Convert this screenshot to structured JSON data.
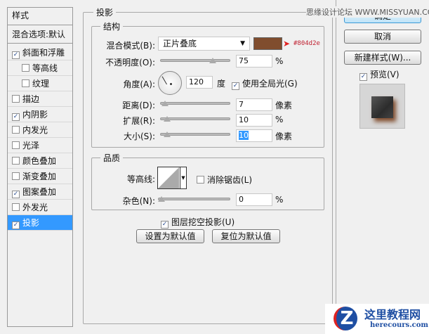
{
  "sidebar": {
    "title": "样式",
    "blend_options": "混合选项:默认",
    "items": [
      {
        "label": "斜面和浮雕",
        "checked": true
      },
      {
        "label": "等高线",
        "checked": false
      },
      {
        "label": "纹理",
        "checked": false
      },
      {
        "label": "描边",
        "checked": false
      },
      {
        "label": "内阴影",
        "checked": true
      },
      {
        "label": "内发光",
        "checked": false
      },
      {
        "label": "光泽",
        "checked": false
      },
      {
        "label": "颜色叠加",
        "checked": false
      },
      {
        "label": "渐变叠加",
        "checked": false
      },
      {
        "label": "图案叠加",
        "checked": true
      },
      {
        "label": "外发光",
        "checked": false
      },
      {
        "label": "投影",
        "checked": true,
        "selected": true
      }
    ]
  },
  "panel": {
    "title": "投影",
    "structure": {
      "title": "结构",
      "blend_mode_label": "混合模式(B):",
      "blend_mode": "正片叠底",
      "color": "#804d2e",
      "color_annotation": "#804d2e",
      "opacity_label": "不透明度(O):",
      "opacity": "75",
      "opacity_unit": "%",
      "angle_label": "角度(A):",
      "angle": "120",
      "angle_unit": "度",
      "global_light_label": "使用全局光(G)",
      "distance_label": "距离(D):",
      "distance": "7",
      "distance_unit": "像素",
      "spread_label": "扩展(R):",
      "spread": "10",
      "spread_unit": "%",
      "size_label": "大小(S):",
      "size": "10",
      "size_unit": "像素"
    },
    "quality": {
      "title": "品质",
      "contour_label": "等高线:",
      "antialias_label": "消除锯齿(L)",
      "noise_label": "杂色(N):",
      "noise": "0",
      "noise_unit": "%"
    },
    "knockout_label": "图层挖空投影(U)",
    "set_default": "设置为默认值",
    "reset_default": "复位为默认值"
  },
  "buttons": {
    "ok": "确定",
    "cancel": "取消",
    "new_style": "新建样式(W)...",
    "preview": "预览(V)"
  },
  "watermark": {
    "top": "思缘设计论坛 WWW.MISSYUAN.COM",
    "logo_cn": "这里教程网",
    "logo_en": "herecours.com"
  }
}
